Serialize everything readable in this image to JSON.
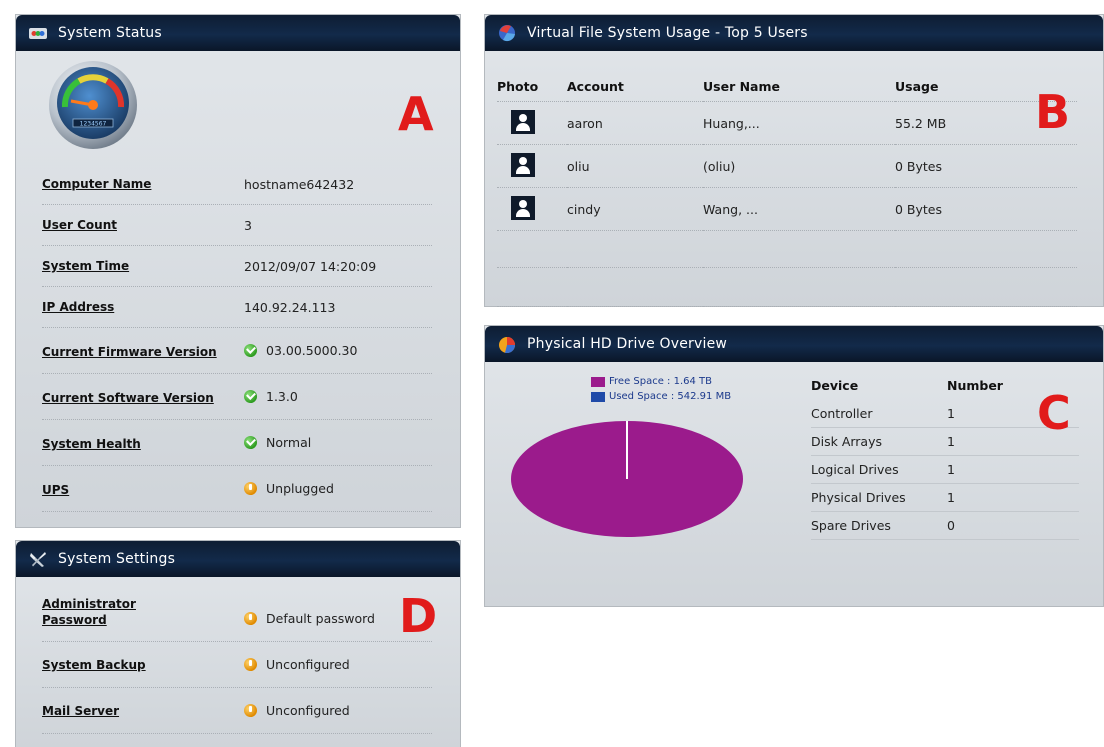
{
  "system_status": {
    "title": "System Status",
    "letter": "A",
    "rows": [
      {
        "label": "Computer Name",
        "value": "hostname642432",
        "status": ""
      },
      {
        "label": "User Count",
        "value": "3",
        "status": ""
      },
      {
        "label": "System Time",
        "value": "2012/09/07 14:20:09",
        "status": ""
      },
      {
        "label": "IP Address",
        "value": "140.92.24.113",
        "status": ""
      },
      {
        "label": "Current Firmware Version",
        "value": "03.00.5000.30",
        "status": "ok"
      },
      {
        "label": "Current Software Version",
        "value": "1.3.0",
        "status": "ok"
      },
      {
        "label": "System Health",
        "value": "Normal",
        "status": "ok"
      },
      {
        "label": "UPS",
        "value": "Unplugged",
        "status": "warning"
      }
    ]
  },
  "vfs_usage": {
    "title": "Virtual File System Usage - Top 5 Users",
    "letter": "B",
    "columns": [
      "Photo",
      "Account",
      "User Name",
      "Usage"
    ],
    "rows": [
      {
        "account": "aaron",
        "user_name": "Huang,...",
        "usage": "55.2 MB"
      },
      {
        "account": "oliu",
        "user_name": "(oliu)",
        "usage": "0 Bytes"
      },
      {
        "account": "cindy",
        "user_name": "Wang, ...",
        "usage": "0 Bytes"
      }
    ]
  },
  "hd_overview": {
    "title": "Physical HD Drive Overview",
    "letter": "C",
    "legend": [
      {
        "label": "Free Space : 1.64 TB",
        "color": "#9b1b8c"
      },
      {
        "label": "Used Space : 542.91 MB",
        "color": "#1f4aa8"
      }
    ],
    "pie": {
      "free_fraction": 0.9997,
      "used_fraction": 0.0003
    },
    "columns": [
      "Device",
      "Number"
    ],
    "rows": [
      {
        "device": "Controller",
        "number": "1"
      },
      {
        "device": "Disk Arrays",
        "number": "1"
      },
      {
        "device": "Logical Drives",
        "number": "1"
      },
      {
        "device": "Physical Drives",
        "number": "1"
      },
      {
        "device": "Spare Drives",
        "number": "0"
      }
    ]
  },
  "system_settings": {
    "title": "System Settings",
    "letter": "D",
    "rows": [
      {
        "label_line1": "Administrator",
        "label_line2": "Password",
        "value": "Default password",
        "status": "warning"
      },
      {
        "label": "System Backup",
        "value": "Unconfigured",
        "status": "warning"
      },
      {
        "label": "Mail Server",
        "value": "Unconfigured",
        "status": "warning"
      }
    ]
  },
  "colors": {
    "header_bg": "#0e1d33",
    "panel_bg": "#d9dde1",
    "annotation_red": "#e11b1b",
    "ok_green": "#2d9b1f",
    "warning_orange": "#e08a00"
  }
}
